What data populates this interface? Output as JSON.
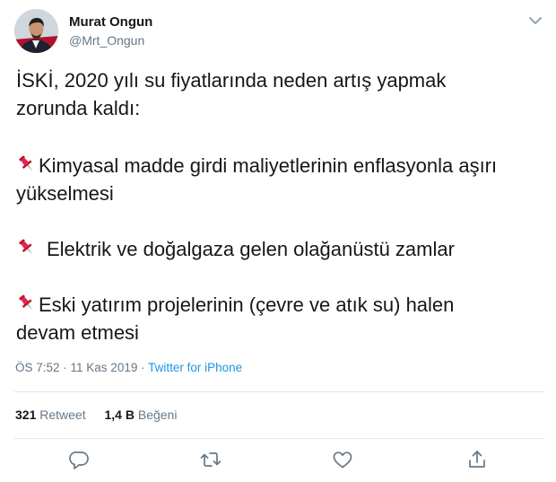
{
  "author": {
    "display_name": "Murat Ongun",
    "handle": "@Mrt_Ongun"
  },
  "tweet": {
    "paragraphs": [
      {
        "lines": [
          "İSKİ, 2020 yılı su fiyatlarında neden artış yapmak",
          "zorunda kaldı:"
        ]
      },
      {
        "icon": "pushpin-icon",
        "lines": [
          "Kimyasal madde girdi maliyetlerinin enflasyonla aşırı",
          "yükselmesi"
        ]
      },
      {
        "icon": "pushpin-icon",
        "lines": [
          "Elektrik ve doğalgaza gelen olağanüstü zamlar"
        ]
      },
      {
        "icon": "pushpin-icon",
        "lines": [
          "Eski yatırım projelerinin (çevre ve atık su) halen",
          "devam etmesi"
        ]
      }
    ]
  },
  "meta": {
    "time": "ÖS 7:52",
    "separator1": " · ",
    "date": "11 Kas 2019",
    "separator2": " · ",
    "source": "Twitter for iPhone"
  },
  "stats": {
    "retweets_count": "321",
    "retweets_label": "Retweet",
    "likes_count": "1,4 B",
    "likes_label": "Beğeni"
  },
  "actions": [
    "reply-icon",
    "retweet-icon",
    "like-icon",
    "share-icon"
  ],
  "colors": {
    "text": "#14171a",
    "secondary": "#657786",
    "link": "#1b95e0",
    "divider": "#e1e8ed",
    "pin": "#e0245e"
  }
}
